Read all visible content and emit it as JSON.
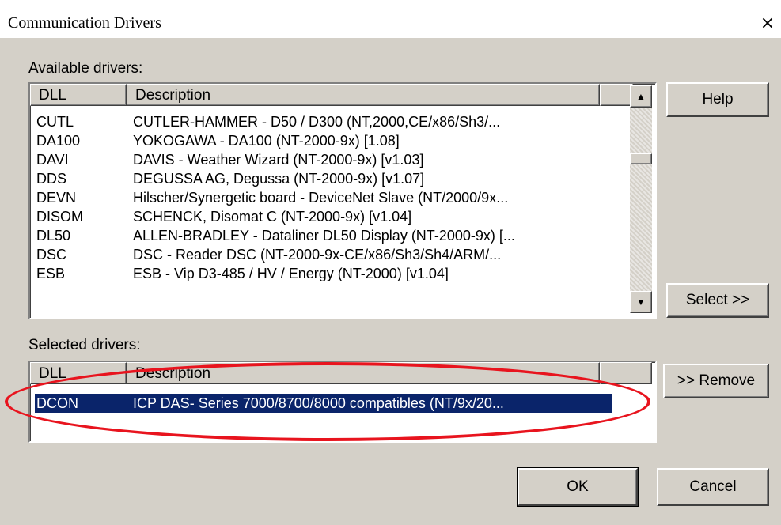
{
  "window": {
    "title": "Communication Drivers",
    "close_glyph": "×"
  },
  "available": {
    "label": "Available drivers:",
    "columns": [
      "DLL",
      "Description"
    ],
    "rows": [
      {
        "dll": "CUTL",
        "desc": "CUTLER-HAMMER - D50 / D300 (NT,2000,CE/x86/Sh3/..."
      },
      {
        "dll": "DA100",
        "desc": "YOKOGAWA - DA100 (NT-2000-9x) [1.08]"
      },
      {
        "dll": "DAVI",
        "desc": "DAVIS - Weather Wizard (NT-2000-9x) [v1.03]"
      },
      {
        "dll": "DDS",
        "desc": "DEGUSSA AG, Degussa (NT-2000-9x) [v1.07]"
      },
      {
        "dll": "DEVN",
        "desc": "Hilscher/Synergetic board - DeviceNet Slave (NT/2000/9x..."
      },
      {
        "dll": "DISOM",
        "desc": "SCHENCK, Disomat C (NT-2000-9x) [v1.04]"
      },
      {
        "dll": "DL50",
        "desc": "ALLEN-BRADLEY - Dataliner DL50 Display (NT-2000-9x) [..."
      },
      {
        "dll": "DSC",
        "desc": "DSC  - Reader DSC (NT-2000-9x-CE/x86/Sh3/Sh4/ARM/..."
      },
      {
        "dll": "ESB",
        "desc": "ESB - Vip D3-485 / HV / Energy (NT-2000) [v1.04]"
      }
    ],
    "scroll_up_icon": "▲",
    "scroll_down_icon": "▼"
  },
  "selected": {
    "label": "Selected drivers:",
    "columns": [
      "DLL",
      "Description"
    ],
    "rows": [
      {
        "dll": "DCON",
        "desc": "ICP DAS- Series 7000/8700/8000 compatibles (NT/9x/20..."
      }
    ]
  },
  "buttons": {
    "help": "Help",
    "select": "Select >>",
    "remove": ">> Remove",
    "ok": "OK",
    "cancel": "Cancel"
  },
  "colors": {
    "face": "#d4d0c8",
    "selection": "#0a246a",
    "annotation": "#e8141e"
  }
}
